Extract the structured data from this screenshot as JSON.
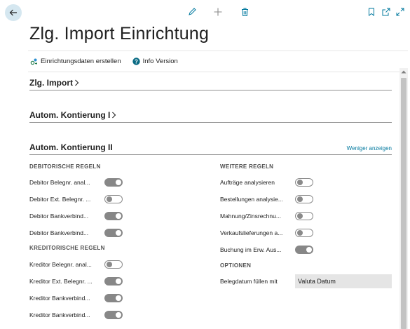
{
  "page": {
    "title": "Zlg. Import Einrichtung"
  },
  "actions": [
    {
      "label": "Einrichtungsdaten erstellen",
      "icon": "setup-data-icon"
    },
    {
      "label": "Info Version",
      "icon": "help-circle-icon"
    }
  ],
  "sections": {
    "zlg_import": {
      "title": "Zlg. Import"
    },
    "kontierung_1": {
      "title": "Autom. Kontierung I"
    },
    "kontierung_2": {
      "title": "Autom. Kontierung II",
      "show_less": "Weniger anzeigen"
    }
  },
  "groups": {
    "debitor": {
      "title": "DEBITORISCHE REGELN",
      "fields": [
        {
          "label": "Debitor Belegnr. anal...",
          "value": true
        },
        {
          "label": "Debitor Ext. Belegnr. ...",
          "value": false
        },
        {
          "label": "Debitor Bankverbind...",
          "value": true
        },
        {
          "label": "Debitor Bankverbind...",
          "value": true
        }
      ]
    },
    "kreditor": {
      "title": "KREDITORISCHE REGELN",
      "fields": [
        {
          "label": "Kreditor Belegnr. anal...",
          "value": false
        },
        {
          "label": "Kreditor Ext. Belegnr. ...",
          "value": true
        },
        {
          "label": "Kreditor Bankverbind...",
          "value": true
        },
        {
          "label": "Kreditor Bankverbind...",
          "value": true
        }
      ]
    },
    "weitere": {
      "title": "WEITERE REGELN",
      "fields": [
        {
          "label": "Aufträge analysieren",
          "value": false
        },
        {
          "label": "Bestellungen analysie...",
          "value": false
        },
        {
          "label": "Mahnung/Zinsrechnu...",
          "value": false
        },
        {
          "label": "Verkaufslieferungen a...",
          "value": false
        },
        {
          "label": "Buchung im Erw. Aus...",
          "value": true
        }
      ]
    },
    "optionen": {
      "title": "OPTIONEN",
      "fields": [
        {
          "label": "Belegdatum füllen mit",
          "value": "Valuta Datum"
        }
      ]
    }
  },
  "colors": {
    "accent": "#00789e",
    "toggle_on": "#878787",
    "back_button_bg": "#d5e7f0"
  }
}
